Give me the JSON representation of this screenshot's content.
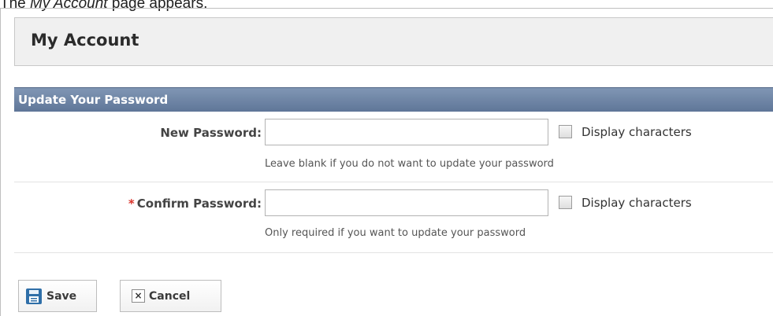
{
  "caption": {
    "prefix": "The ",
    "emphasis": "My Account",
    "suffix": " page appears."
  },
  "page": {
    "title": "My Account"
  },
  "section": {
    "title": "Update Your Password"
  },
  "fields": {
    "new_password": {
      "label": "New Password:",
      "value": "",
      "display_label": "Display characters",
      "display_checked": false,
      "hint": "Leave blank if you do not want to update your password"
    },
    "confirm_password": {
      "required_marker": "*",
      "label": "Confirm Password:",
      "value": "",
      "display_label": "Display characters",
      "display_checked": false,
      "hint": "Only required if you want to update your password"
    }
  },
  "buttons": {
    "save_label": "Save",
    "cancel_label": "Cancel"
  },
  "colors": {
    "section_header": "#6b81a3",
    "required_star": "#d9342b",
    "save_icon": "#2f6fa8"
  },
  "icons": {
    "save": "floppy-disk-icon",
    "cancel": "close-icon"
  }
}
